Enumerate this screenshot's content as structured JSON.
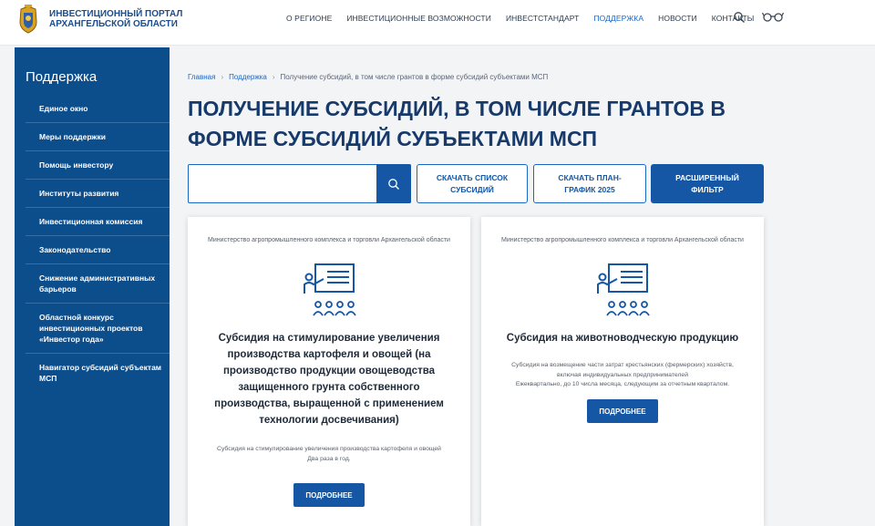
{
  "header": {
    "logo_line1": "Инвестиционный портал",
    "logo_line2": "Архангельской области",
    "nav": [
      {
        "label": "О РЕГИОНЕ"
      },
      {
        "label": "ИНВЕСТИЦИОННЫЕ ВОЗМОЖНОСТИ"
      },
      {
        "label": "ИНВЕСТСТАНДАРТ"
      },
      {
        "label": "ПОДДЕРЖКА"
      },
      {
        "label": "НОВОСТИ"
      },
      {
        "label": "КОНТАКТЫ"
      }
    ],
    "active_nav": "ПОДДЕРЖКА",
    "icons": [
      "search-icon",
      "glasses-icon"
    ]
  },
  "sidebar": {
    "title": "Поддержка",
    "items": [
      {
        "label": "Единое окно"
      },
      {
        "label": "Меры поддержки"
      },
      {
        "label": "Помощь инвестору"
      },
      {
        "label": "Институты развития"
      },
      {
        "label": "Инвестиционная комиссия"
      },
      {
        "label": "Законодательство"
      },
      {
        "label": "Снижение административных барьеров"
      },
      {
        "label": "Областной конкурс инвестиционных проектов «Инвестор года»"
      },
      {
        "label": "Навигатор субсидий субъектам МСП"
      }
    ]
  },
  "breadcrumb": {
    "home": "Главная",
    "parent": "Поддержка",
    "current": "Получение субсидий, в том числе грантов в форме субсидий субъектами МСП"
  },
  "page_title": "Получение субсидий, в том числе грантов в форме субсидий субъектами МСП",
  "search": {
    "placeholder": "",
    "value": ""
  },
  "buttons": {
    "download_list": "Скачать список субсидий",
    "download_plan": "Скачать план-график 2025",
    "extended_filter": "Расширенный фильтр"
  },
  "cards": [
    {
      "ministry": "Министерство агропромышленного комплекса и торговли Архангельской области",
      "title": "Субсидия на стимулирование увеличения производства картофеля и овощей (на производство продукции овощеводства защищенного грунта собственного производства, выращенной с применением технологии досвечивания)",
      "desc1": "Субсидия на стимулирование увеличения производства картофеля и овощей",
      "desc2": "Два раза в год.",
      "button": "Подробнее"
    },
    {
      "ministry": "Министерство агропромышленного комплекса и торговли Архангельской области",
      "title": "Субсидия на животноводческую продукцию",
      "desc1": "Субсидия на возмещение части затрат крестьянских (фермерских) хозяйств, включая индивидуальных предпринимателей",
      "desc2": "Ежеквартально, до 10 числа месяца, следующим за отчетным кварталом.",
      "button": "Подробнее"
    }
  ],
  "colors": {
    "brand_blue": "#0c4d8c",
    "button_blue": "#1557a5",
    "link_blue": "#1b67c4",
    "title_navy": "#173a6b"
  }
}
